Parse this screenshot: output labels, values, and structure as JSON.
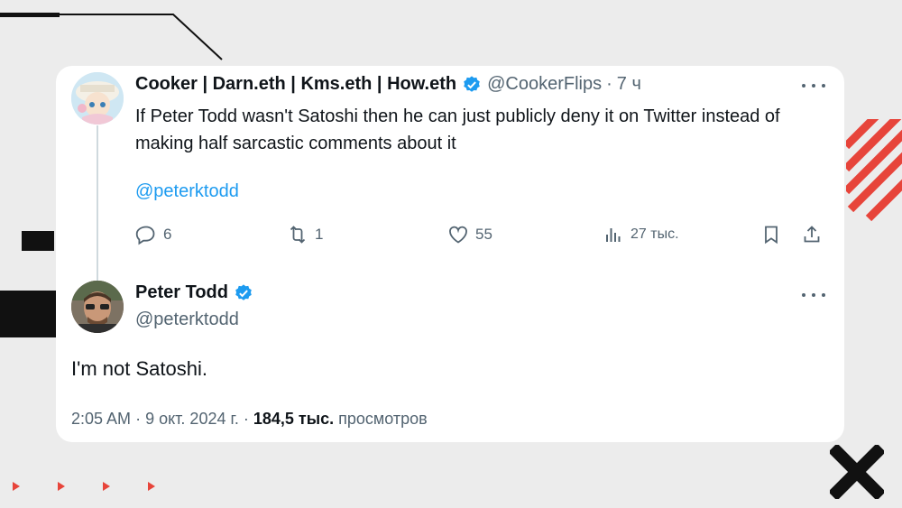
{
  "tweet1": {
    "display_name": "Cooker | Darn.eth | Kms.eth | How.eth",
    "handle": "@CookerFlips",
    "separator": "·",
    "time": "7 ч",
    "text": "If Peter Todd wasn't Satoshi then he can just publicly deny it on Twitter instead of making half sarcastic comments about it",
    "mention": "@peterktodd",
    "replies": "6",
    "retweets": "1",
    "likes": "55",
    "views": "27 тыс."
  },
  "tweet2": {
    "display_name": "Peter Todd",
    "handle": "@peterktodd",
    "text": "I'm not Satoshi.",
    "time": "2:05 AM",
    "date": "9 окт. 2024 г.",
    "separator": "·",
    "views_count": "184,5 тыс.",
    "views_label": "просмотров"
  },
  "colors": {
    "link": "#1d9bf0",
    "secondary_text": "#536471",
    "verified_badge": "#1d9bf0",
    "accent_decor": "#e7443a"
  },
  "icons": {
    "more": "more-horizontal-icon",
    "reply": "reply-icon",
    "retweet": "retweet-icon",
    "like": "heart-icon",
    "views": "analytics-icon",
    "bookmark": "bookmark-icon",
    "share": "share-icon",
    "verified": "verified-badge-icon"
  }
}
